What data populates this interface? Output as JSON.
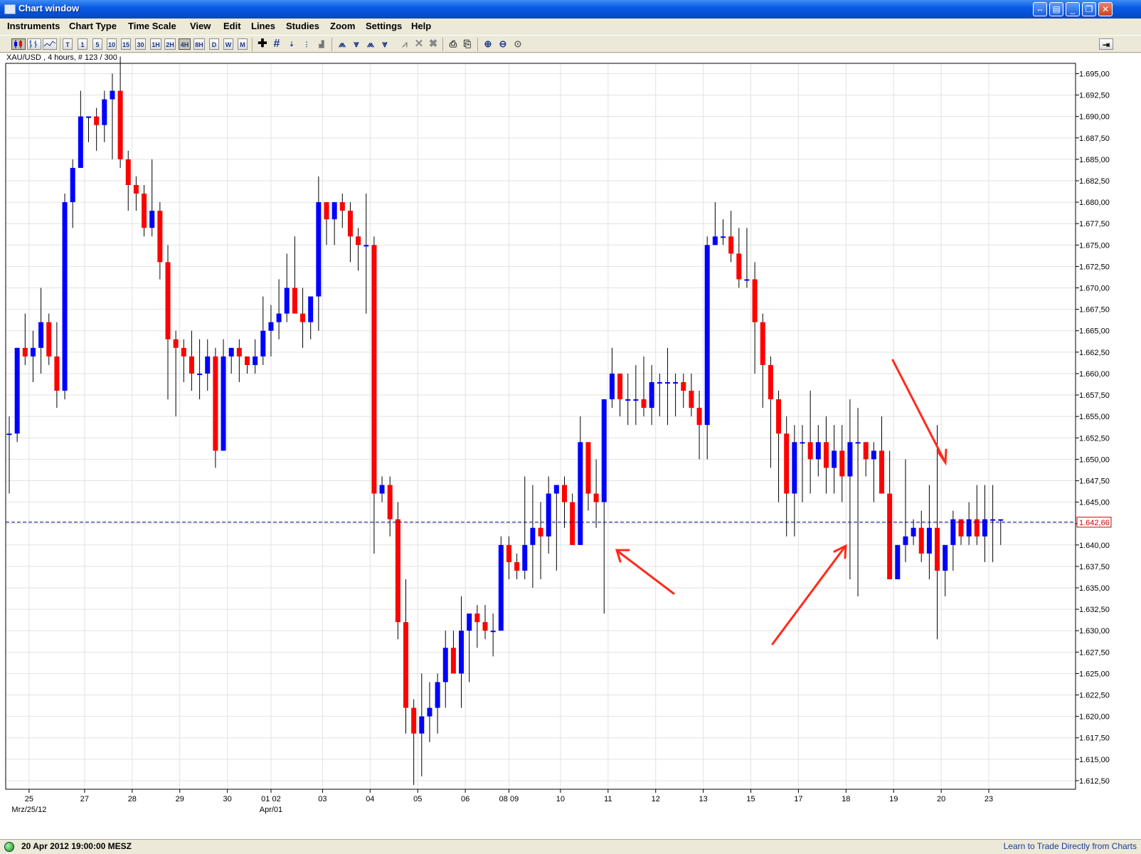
{
  "window": {
    "title": "Chart window"
  },
  "menu": [
    "Instruments",
    "Chart Type",
    "Time Scale",
    "View",
    "Edit",
    "Lines",
    "Studies",
    "Zoom",
    "Settings",
    "Help"
  ],
  "toolbar": {
    "timeframes": [
      "T",
      "1",
      "5",
      "10",
      "15",
      "30",
      "1H",
      "2H",
      "4H",
      "8H",
      "D",
      "W",
      "M"
    ],
    "active_timeframe": "4H"
  },
  "chart": {
    "info": "XAU/USD , 4 hours, # 123 / 300"
  },
  "status": {
    "datetime": "20 Apr 2012 19:00:00 MESZ",
    "link": "Learn to Trade Directly from Charts"
  },
  "colors": {
    "up": "#0000FF",
    "down": "#FF0000",
    "arrow": "#FF2A1A",
    "price_line": "#000080"
  },
  "chart_data": {
    "type": "candlestick",
    "symbol": "XAU/USD",
    "timeframe": "4 hours",
    "current_price": "1.642,66",
    "current_value": 1642.66,
    "y_ticks": [
      "1.695,00",
      "1.692,50",
      "1.690,00",
      "1.687,50",
      "1.685,00",
      "1.682,50",
      "1.680,00",
      "1.677,50",
      "1.675,00",
      "1.672,50",
      "1.670,00",
      "1.667,50",
      "1.665,00",
      "1.662,50",
      "1.660,00",
      "1.657,50",
      "1.655,00",
      "1.652,50",
      "1.650,00",
      "1.647,50",
      "1.645,00",
      "1.642,50",
      "1.640,00",
      "1.637,50",
      "1.635,00",
      "1.632,50",
      "1.630,00",
      "1.627,50",
      "1.625,00",
      "1.622,50",
      "1.620,00",
      "1.617,50",
      "1.615,00",
      "1.612,50"
    ],
    "y_tick_values": [
      1695,
      1692.5,
      1690,
      1687.5,
      1685,
      1682.5,
      1680,
      1677.5,
      1675,
      1672.5,
      1670,
      1667.5,
      1665,
      1662.5,
      1660,
      1657.5,
      1655,
      1652.5,
      1650,
      1647.5,
      1645,
      1642.5,
      1640,
      1637.5,
      1635,
      1632.5,
      1630,
      1627.5,
      1625,
      1622.5,
      1620,
      1617.5,
      1615,
      1612.5
    ],
    "ylim": [
      1611.5,
      1696.2
    ],
    "x_ticks": [
      {
        "label": "25",
        "index": 2.5
      },
      {
        "label": "27",
        "index": 9.5
      },
      {
        "label": "28",
        "index": 15.5
      },
      {
        "label": "29",
        "index": 21.5
      },
      {
        "label": "30",
        "index": 27.5
      },
      {
        "label": "01 02",
        "index": 33
      },
      {
        "label": "03",
        "index": 39.5
      },
      {
        "label": "04",
        "index": 45.5
      },
      {
        "label": "05",
        "index": 51.5
      },
      {
        "label": "06",
        "index": 57.5
      },
      {
        "label": "08 09",
        "index": 63
      },
      {
        "label": "10",
        "index": 69.5
      },
      {
        "label": "11",
        "index": 75.5
      },
      {
        "label": "12",
        "index": 81.5
      },
      {
        "label": "13",
        "index": 87.5
      },
      {
        "label": "15",
        "index": 93.5
      },
      {
        "label": "17",
        "index": 99.5
      },
      {
        "label": "18",
        "index": 105.5
      },
      {
        "label": "19",
        "index": 111.5
      },
      {
        "label": "20",
        "index": 117.5
      },
      {
        "label": "23",
        "index": 123.5
      }
    ],
    "x_subticks": [
      {
        "label": "Mrz/25/12",
        "index": 2.5
      },
      {
        "label": "Apr/01",
        "index": 33
      }
    ],
    "candles": [
      [
        1653,
        1655,
        1646,
        1653
      ],
      [
        1653,
        1663,
        1652,
        1663
      ],
      [
        1663,
        1667,
        1661,
        1662
      ],
      [
        1662,
        1665,
        1659,
        1663
      ],
      [
        1663,
        1670,
        1660,
        1666
      ],
      [
        1666,
        1667,
        1661,
        1662
      ],
      [
        1662,
        1666,
        1656,
        1658
      ],
      [
        1658,
        1681,
        1657,
        1680
      ],
      [
        1680,
        1685,
        1677,
        1684
      ],
      [
        1684,
        1693,
        1684,
        1690
      ],
      [
        1690,
        1690,
        1687,
        1690
      ],
      [
        1690,
        1691,
        1686,
        1689
      ],
      [
        1689,
        1693,
        1687,
        1692
      ],
      [
        1692,
        1695,
        1685,
        1693
      ],
      [
        1693,
        1697,
        1684,
        1685
      ],
      [
        1685,
        1686,
        1679,
        1682
      ],
      [
        1682,
        1683,
        1679,
        1681
      ],
      [
        1681,
        1682,
        1676,
        1677
      ],
      [
        1677,
        1685,
        1676,
        1679
      ],
      [
        1679,
        1680,
        1671,
        1673
      ],
      [
        1673,
        1675,
        1657,
        1664
      ],
      [
        1664,
        1665,
        1655,
        1663
      ],
      [
        1663,
        1664,
        1659,
        1662
      ],
      [
        1662,
        1665,
        1658,
        1660
      ],
      [
        1660,
        1664,
        1657,
        1660
      ],
      [
        1660,
        1664,
        1658,
        1662
      ],
      [
        1662,
        1663,
        1649,
        1651
      ],
      [
        1651,
        1664,
        1651,
        1662
      ],
      [
        1662,
        1663,
        1660,
        1663
      ],
      [
        1663,
        1664,
        1659,
        1662
      ],
      [
        1662,
        1662,
        1660,
        1661
      ],
      [
        1661,
        1664,
        1660,
        1662
      ],
      [
        1662,
        1669,
        1661,
        1665
      ],
      [
        1665,
        1668,
        1662,
        1666
      ],
      [
        1666,
        1671,
        1664,
        1667
      ],
      [
        1667,
        1674,
        1666,
        1670
      ],
      [
        1670,
        1676,
        1668,
        1667
      ],
      [
        1667,
        1670,
        1663,
        1666
      ],
      [
        1666,
        1669,
        1664,
        1669
      ],
      [
        1669,
        1683,
        1665,
        1680
      ],
      [
        1680,
        1680,
        1675,
        1678
      ],
      [
        1678,
        1680,
        1675,
        1680
      ],
      [
        1680,
        1681,
        1677,
        1679
      ],
      [
        1679,
        1680,
        1673,
        1676
      ],
      [
        1676,
        1677,
        1672,
        1675
      ],
      [
        1675,
        1681,
        1667,
        1675
      ],
      [
        1675,
        1676,
        1639,
        1646
      ],
      [
        1646,
        1648,
        1645,
        1647
      ],
      [
        1647,
        1648,
        1641,
        1643
      ],
      [
        1643,
        1645,
        1629,
        1631
      ],
      [
        1631,
        1636,
        1618,
        1621
      ],
      [
        1621,
        1622,
        1612,
        1618
      ],
      [
        1618,
        1625,
        1613,
        1620
      ],
      [
        1620,
        1624,
        1617,
        1621
      ],
      [
        1621,
        1625,
        1618,
        1624
      ],
      [
        1624,
        1630,
        1621,
        1628
      ],
      [
        1628,
        1630,
        1626,
        1625
      ],
      [
        1625,
        1634,
        1621,
        1630
      ],
      [
        1630,
        1631,
        1624,
        1632
      ],
      [
        1632,
        1633,
        1628,
        1631
      ],
      [
        1631,
        1633,
        1629,
        1630
      ],
      [
        1630,
        1632,
        1627,
        1630
      ],
      [
        1630,
        1641,
        1630,
        1640
      ],
      [
        1640,
        1641,
        1636,
        1638
      ],
      [
        1638,
        1639,
        1636,
        1637
      ],
      [
        1637,
        1648,
        1636,
        1640
      ],
      [
        1640,
        1647,
        1635,
        1642
      ],
      [
        1642,
        1645,
        1636,
        1641
      ],
      [
        1641,
        1648,
        1639,
        1646
      ],
      [
        1646,
        1647,
        1637,
        1647
      ],
      [
        1647,
        1648,
        1642,
        1645
      ],
      [
        1645,
        1646,
        1640,
        1640
      ],
      [
        1640,
        1655,
        1640,
        1652
      ],
      [
        1652,
        1652,
        1644,
        1646
      ],
      [
        1646,
        1650,
        1642,
        1645
      ],
      [
        1645,
        1657,
        1632,
        1657
      ],
      [
        1657,
        1663,
        1656,
        1660
      ],
      [
        1660,
        1660,
        1655,
        1657
      ],
      [
        1657,
        1660,
        1654,
        1657
      ],
      [
        1657,
        1661,
        1654,
        1657
      ],
      [
        1657,
        1662,
        1655,
        1656
      ],
      [
        1656,
        1661,
        1654,
        1659
      ],
      [
        1659,
        1660,
        1655,
        1659
      ],
      [
        1659,
        1663,
        1654,
        1659
      ],
      [
        1659,
        1660,
        1655,
        1659
      ],
      [
        1659,
        1660,
        1656,
        1658
      ],
      [
        1658,
        1660,
        1655,
        1656
      ],
      [
        1656,
        1658,
        1650,
        1654
      ],
      [
        1654,
        1676,
        1650,
        1675
      ],
      [
        1675,
        1680,
        1675,
        1676
      ],
      [
        1676,
        1678,
        1675,
        1676
      ],
      [
        1676,
        1679,
        1673,
        1674
      ],
      [
        1674,
        1677,
        1670,
        1671
      ],
      [
        1671,
        1677,
        1670,
        1671
      ],
      [
        1671,
        1673,
        1660,
        1666
      ],
      [
        1666,
        1667,
        1656,
        1661
      ],
      [
        1661,
        1662,
        1649,
        1657
      ],
      [
        1657,
        1658,
        1645,
        1653
      ],
      [
        1653,
        1655,
        1641,
        1646
      ],
      [
        1646,
        1654,
        1641,
        1652
      ],
      [
        1652,
        1654,
        1645,
        1652
      ],
      [
        1652,
        1658,
        1646,
        1650
      ],
      [
        1650,
        1654,
        1648,
        1652
      ],
      [
        1652,
        1655,
        1646,
        1649
      ],
      [
        1649,
        1654,
        1646,
        1651
      ],
      [
        1651,
        1654,
        1645,
        1648
      ],
      [
        1648,
        1657,
        1636,
        1652
      ],
      [
        1652,
        1656,
        1634,
        1652
      ],
      [
        1652,
        1652,
        1648,
        1650
      ],
      [
        1650,
        1652,
        1645,
        1651
      ],
      [
        1651,
        1655,
        1646,
        1646
      ],
      [
        1646,
        1651,
        1640,
        1636
      ],
      [
        1636,
        1640,
        1636,
        1640
      ],
      [
        1640,
        1650,
        1638,
        1641
      ],
      [
        1641,
        1643,
        1640,
        1642
      ],
      [
        1642,
        1644,
        1638,
        1639
      ],
      [
        1639,
        1647,
        1636,
        1642
      ],
      [
        1642,
        1654,
        1629,
        1637
      ],
      [
        1637,
        1638,
        1634,
        1640
      ],
      [
        1640,
        1644,
        1637,
        1643
      ],
      [
        1643,
        1642,
        1640,
        1641
      ],
      [
        1641,
        1645,
        1640,
        1643
      ],
      [
        1643,
        1647,
        1640,
        1641
      ],
      [
        1641,
        1647,
        1638,
        1643
      ],
      [
        1643,
        1647,
        1638,
        1643
      ],
      [
        1643,
        1643,
        1640,
        1643
      ]
    ]
  }
}
